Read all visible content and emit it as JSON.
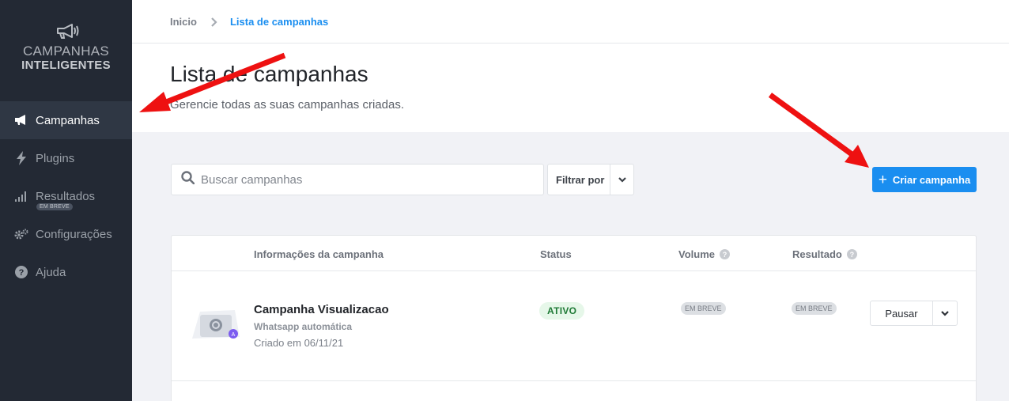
{
  "brand": {
    "line1": "CAMPANHAS",
    "line2": "INTELIGENTES",
    "icon": "megaphone-icon"
  },
  "sidebar": {
    "items": [
      {
        "label": "Campanhas",
        "icon": "megaphone-icon",
        "active": true
      },
      {
        "label": "Plugins",
        "icon": "bolt-icon"
      },
      {
        "label": "Resultados",
        "icon": "signal-bars-icon",
        "badge": "EM BREVE"
      },
      {
        "label": "Configurações",
        "icon": "gears-icon"
      },
      {
        "label": "Ajuda",
        "icon": "question-circle-icon"
      }
    ]
  },
  "breadcrumb": {
    "home": "Inicio",
    "current": "Lista de campanhas"
  },
  "page": {
    "title": "Lista de campanhas",
    "subtitle": "Gerencie todas as suas campanhas criadas."
  },
  "search": {
    "placeholder": "Buscar campanhas",
    "value": ""
  },
  "filter": {
    "label": "Filtrar por"
  },
  "create_button": {
    "label": "Criar campanha"
  },
  "table": {
    "headers": {
      "info": "Informações da campanha",
      "status": "Status",
      "volume": "Volume",
      "result": "Resultado"
    },
    "rows": [
      {
        "name": "Campanha Visualizacao",
        "type": "Whatsapp automática",
        "created": "Criado em 06/11/21",
        "status": "ATIVO",
        "volume": "EM BREVE",
        "result": "EM BREVE",
        "action": "Pausar"
      }
    ]
  },
  "colors": {
    "accent": "#1a8ef0",
    "sidebar": "#232934",
    "annotation": "#ee1111"
  }
}
